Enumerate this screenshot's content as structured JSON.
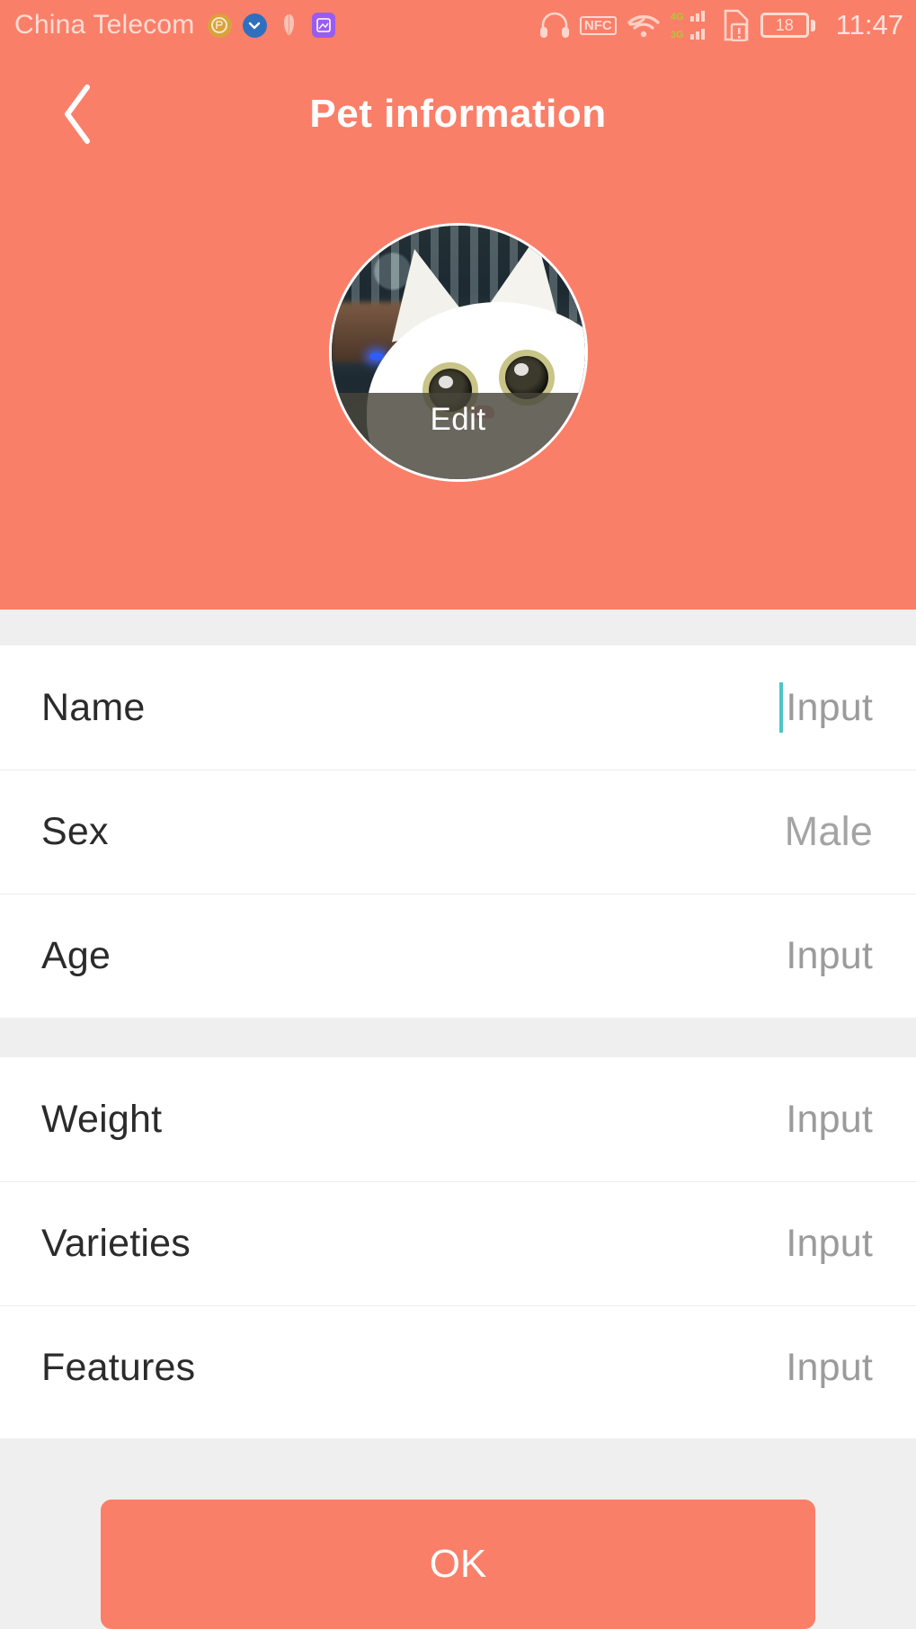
{
  "statusbar": {
    "carrier": "China Telecom",
    "time": "11:47",
    "battery_level": "18",
    "left_icons": [
      {
        "name": "app-badge-icon-1",
        "glyph": "听"
      },
      {
        "name": "app-badge-icon-2",
        "glyph": "∨"
      },
      {
        "name": "app-badge-icon-3",
        "glyph": "☂"
      },
      {
        "name": "app-badge-icon-4",
        "glyph": "⛰"
      }
    ],
    "right_icons": [
      {
        "name": "headphone-icon",
        "glyph": "Ω"
      },
      {
        "name": "nfc-icon",
        "label": "NFC"
      },
      {
        "name": "wifi-icon",
        "glyph": "◔"
      },
      {
        "name": "signal-4g-label",
        "label": "4G"
      },
      {
        "name": "signal-3g-label",
        "label": "3G"
      },
      {
        "name": "sim-warning-icon",
        "glyph": "!"
      }
    ]
  },
  "navbar": {
    "title": "Pet information",
    "back_icon": "chevron-left-icon"
  },
  "avatar": {
    "alt": "pet-photo-white-cat",
    "edit_label": "Edit"
  },
  "form": {
    "groups": [
      {
        "rows": [
          {
            "label": "Name",
            "value": "Input",
            "focused": true,
            "type": "text"
          },
          {
            "label": "Sex",
            "value": "Male",
            "focused": false,
            "type": "select"
          },
          {
            "label": "Age",
            "value": "Input",
            "focused": false,
            "type": "text"
          }
        ]
      },
      {
        "rows": [
          {
            "label": "Weight",
            "value": "Input",
            "focused": false,
            "type": "text"
          },
          {
            "label": "Varieties",
            "value": "Input",
            "focused": false,
            "type": "text"
          },
          {
            "label": "Features",
            "value": "Input",
            "focused": false,
            "type": "text"
          }
        ]
      }
    ]
  },
  "footer": {
    "ok_label": "OK"
  },
  "colors": {
    "accent": "#FA7F69",
    "page_bg": "#EFEFEF",
    "row_bg": "#FFFFFF",
    "label_text": "#2B2B2B",
    "placeholder_text": "#9B9B9B",
    "caret": "#4EC5C8",
    "on_accent_text": "#FFFFFF"
  }
}
